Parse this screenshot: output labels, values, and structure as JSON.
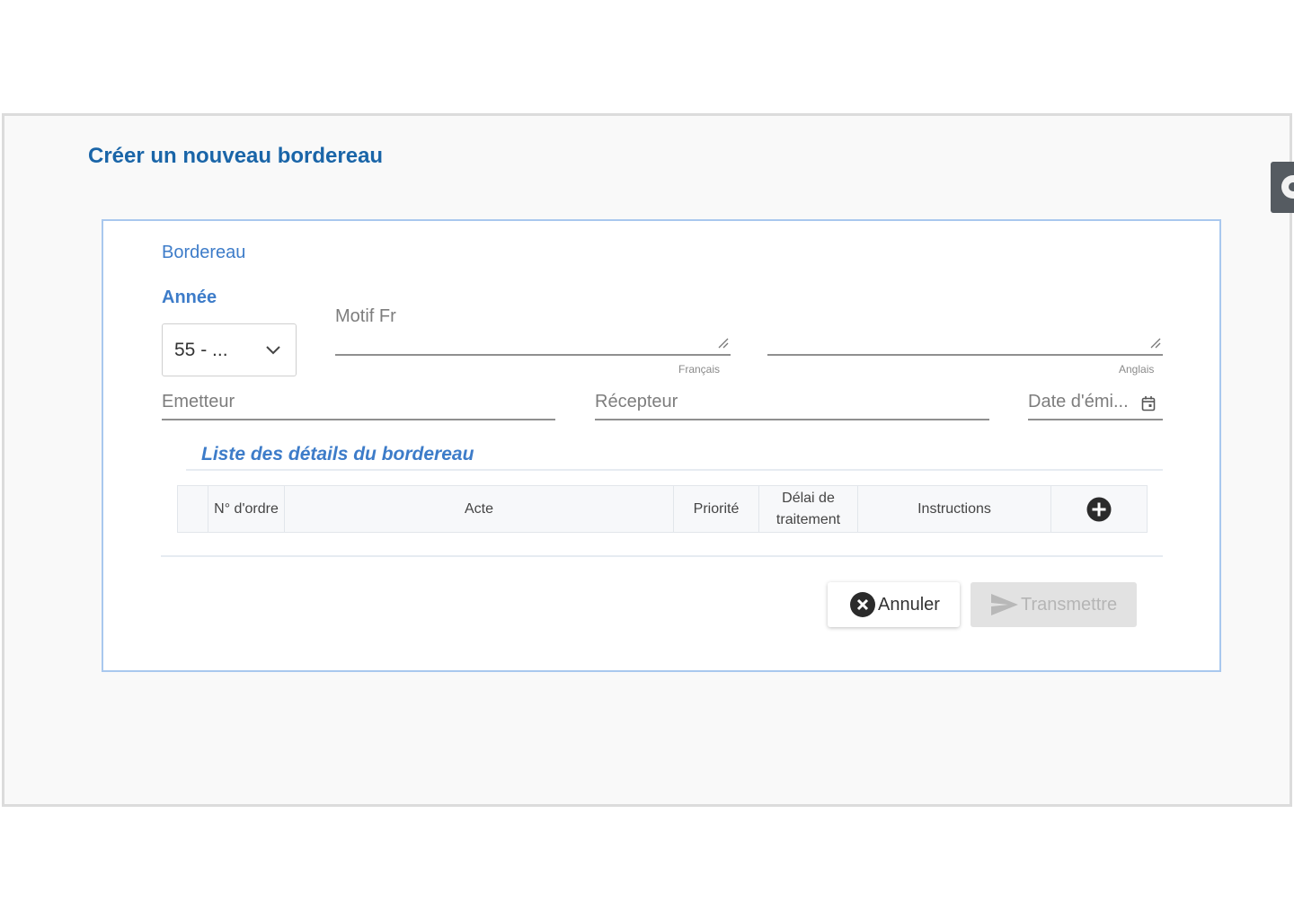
{
  "dialog": {
    "title": "Créer un nouveau bordereau"
  },
  "side_tab": {
    "icon": "gear-icon"
  },
  "form": {
    "section_title": "Bordereau",
    "annee": {
      "label": "Année",
      "selected_value": "55 - ..."
    },
    "motif": {
      "label": "Motif Fr",
      "fr_hint": "Français",
      "en_hint": "Anglais"
    },
    "emetteur": {
      "label": "Emetteur"
    },
    "recepteur": {
      "label": "Récepteur"
    },
    "date_emission": {
      "label": "Date d'émi..."
    }
  },
  "details": {
    "title": "Liste des détails du bordereau",
    "columns": [
      "",
      "N° d'ordre",
      "Acte",
      "Priorité",
      "Délai de traitement",
      "Instructions"
    ]
  },
  "actions": {
    "cancel_label": "Annuler",
    "submit_label": "Transmettre"
  },
  "colors": {
    "title_blue": "#1a65a8",
    "accent_blue": "#3d7cc9",
    "panel_border": "#a9c8ee",
    "disabled_bg": "#e2e2e2"
  }
}
